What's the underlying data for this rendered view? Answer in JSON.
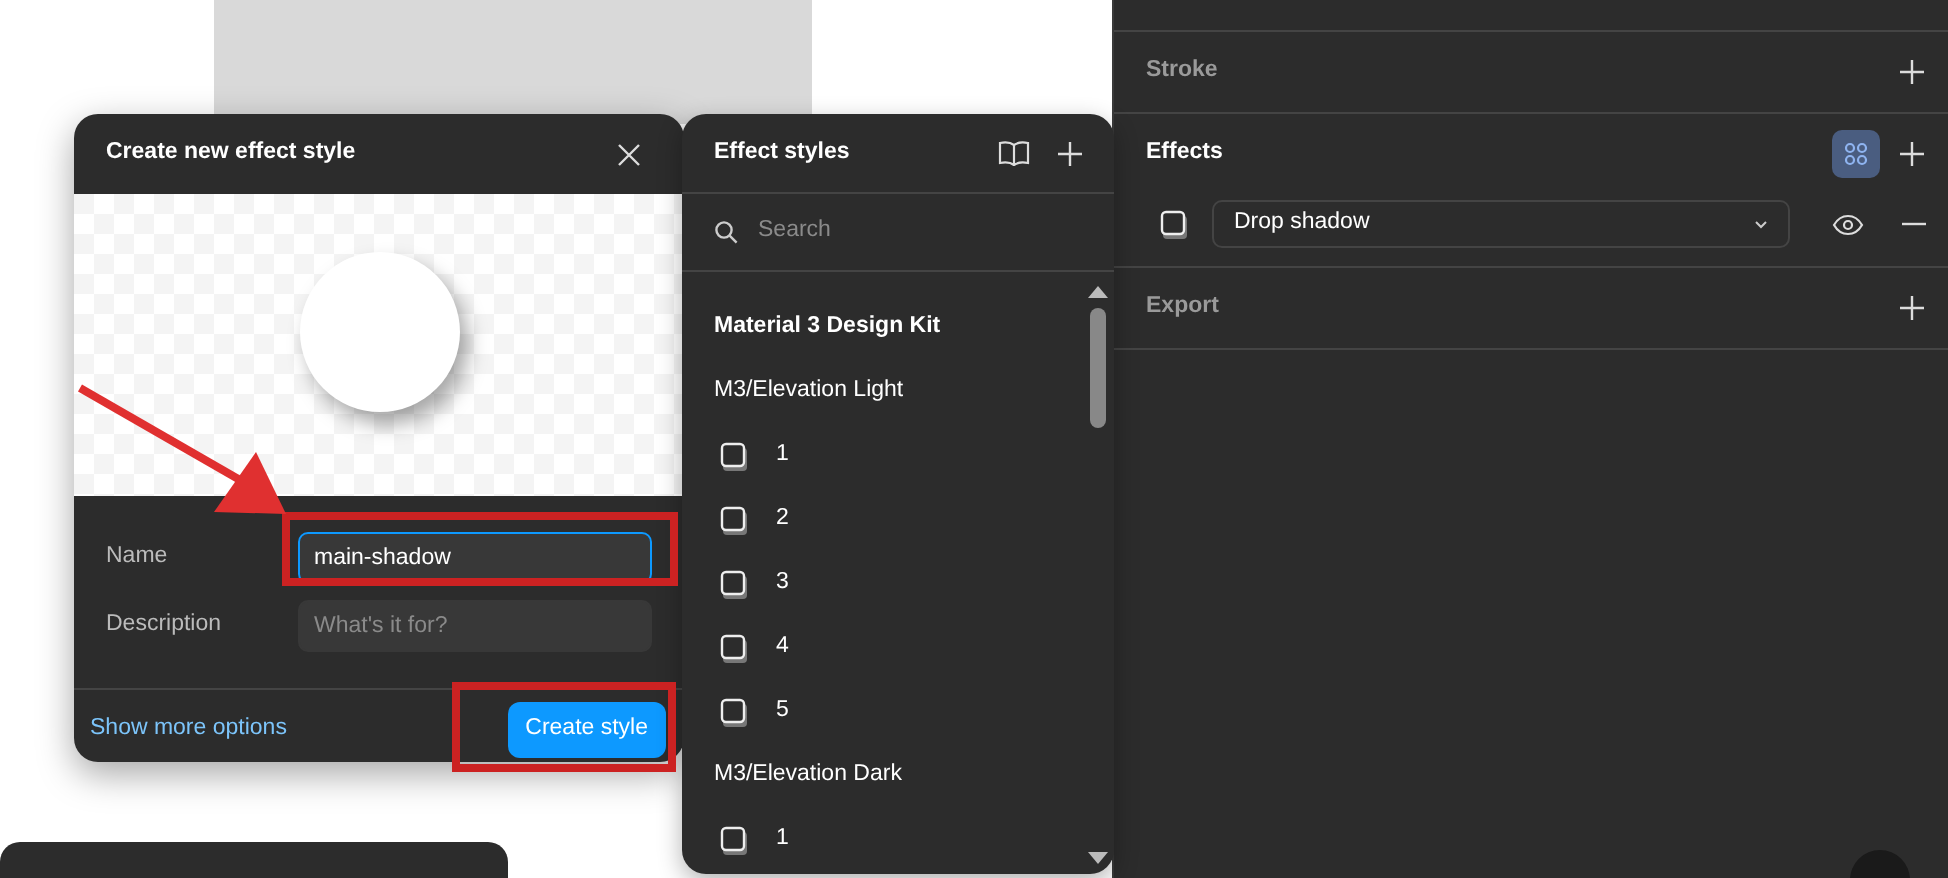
{
  "dialog": {
    "title": "Create new effect style",
    "name_label": "Name",
    "name_value": "main-shadow",
    "description_label": "Description",
    "description_placeholder": "What's it for?",
    "more_link": "Show more options",
    "create_button": "Create style"
  },
  "styles_panel": {
    "title": "Effect styles",
    "search_placeholder": "Search",
    "library": "Material 3 Design Kit",
    "groups": [
      {
        "name": "M3/Elevation Light",
        "items": [
          "1",
          "2",
          "3",
          "4",
          "5"
        ]
      },
      {
        "name": "M3/Elevation Dark",
        "items": [
          "1"
        ]
      }
    ]
  },
  "properties": {
    "sections": [
      {
        "kind": "plain",
        "title": "Stroke",
        "active": false
      },
      {
        "kind": "effects",
        "title": "Effects",
        "active": true,
        "styles_open": true,
        "effects": [
          {
            "type": "Drop shadow",
            "visible": true
          }
        ]
      },
      {
        "kind": "plain",
        "title": "Export",
        "active": false
      }
    ]
  }
}
